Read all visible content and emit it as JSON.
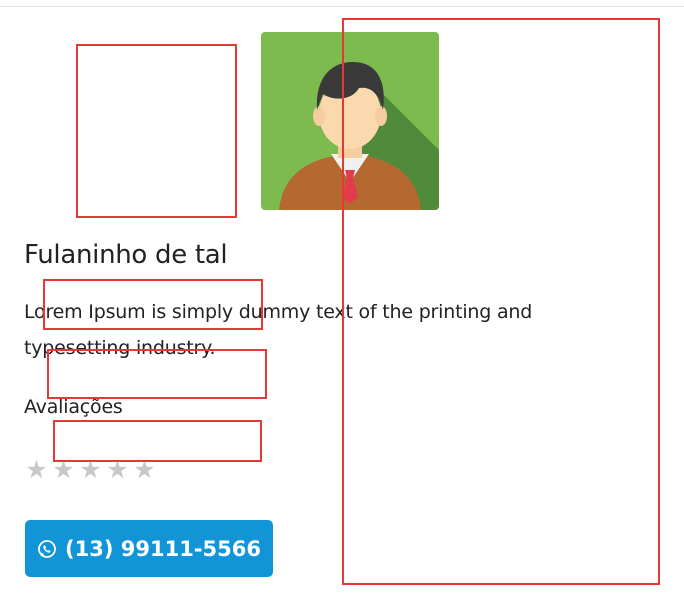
{
  "profile": {
    "name": "Fulaninho de tal",
    "description": "Lorem Ipsum is simply dummy text of the printing and typesetting industry.",
    "avatar_icon": "person-avatar-icon"
  },
  "reviews": {
    "label": "Avaliações",
    "rating": 0,
    "max_rating": 5,
    "star_color": "#c8c8c8"
  },
  "contact": {
    "phone_label": "(13) 99111-5566",
    "button_color": "#1195d6",
    "icon": "whatsapp-icon"
  },
  "colors": {
    "annotation_box": "#e53935"
  }
}
